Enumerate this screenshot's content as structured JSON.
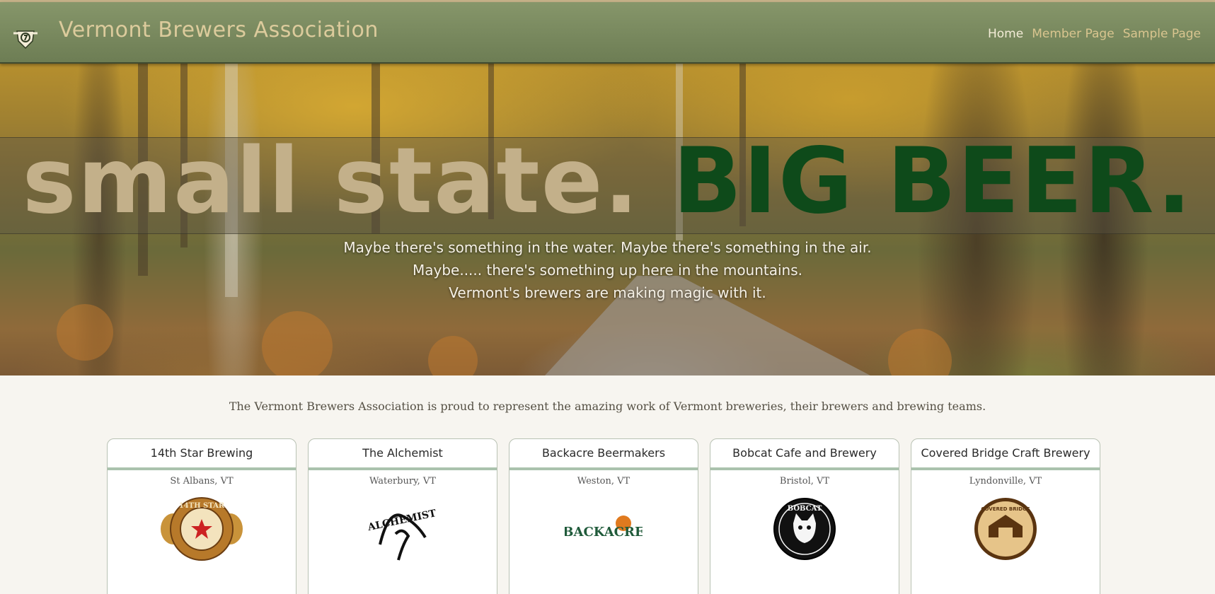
{
  "header": {
    "site_title": "Vermont Brewers Association",
    "logo": "vba-shield-logo-icon",
    "nav": [
      {
        "label": "Home",
        "active": true
      },
      {
        "label": "Member Page",
        "active": false
      },
      {
        "label": "Sample Page",
        "active": false
      }
    ]
  },
  "hero": {
    "headline_small": "small state.",
    "headline_big": "BIG BEER.",
    "subtext": [
      "Maybe there's something in the water. Maybe there's something in the air.",
      "Maybe..... there's something up here in the mountains.",
      "Vermont's brewers are making magic with it."
    ]
  },
  "intro": "The Vermont Brewers Association is proud to represent the amazing work of Vermont breweries, their brewers and brewing teams.",
  "breweries": [
    {
      "name": "14th Star Brewing",
      "location": "St Albans, VT",
      "logo_icon": "14th-star-logo-icon",
      "logo_text": "14TH STAR"
    },
    {
      "name": "The Alchemist",
      "location": "Waterbury, VT",
      "logo_icon": "alchemist-logo-icon",
      "logo_text": "ALCHEMIST"
    },
    {
      "name": "Backacre Beermakers",
      "location": "Weston, VT",
      "logo_icon": "backacre-logo-icon",
      "logo_text": "BACKACRE"
    },
    {
      "name": "Bobcat Cafe and Brewery",
      "location": "Bristol, VT",
      "logo_icon": "bobcat-logo-icon",
      "logo_text": "BOBCAT"
    },
    {
      "name": "Covered Bridge Craft Brewery",
      "location": "Lyndonville, VT",
      "logo_icon": "covered-bridge-logo-icon",
      "logo_text": "COVERED BRIDGE"
    }
  ],
  "colors": {
    "header_bg": "#7a8a5f",
    "title_tan": "#dccb9c",
    "headline_tan": "#c3b08a",
    "headline_green": "#0e4a1a",
    "card_rule": "#aac2ad"
  }
}
